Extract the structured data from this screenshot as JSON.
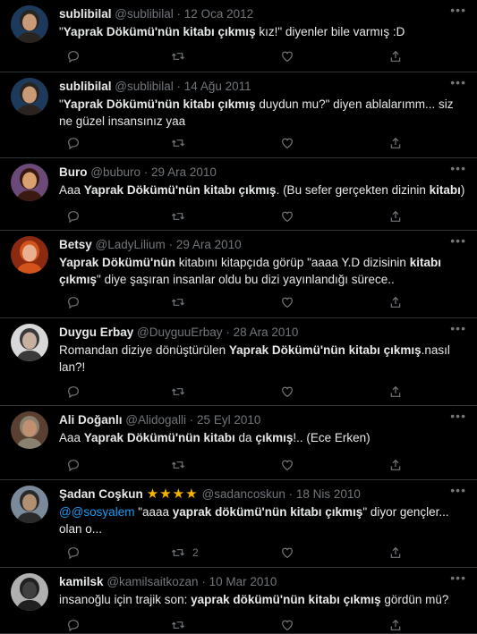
{
  "tweets": [
    {
      "name": "sublibilal",
      "handle": "@sublibilal",
      "dot": "·",
      "date": "12 Oca 2012",
      "text": [
        {
          "t": "\"",
          "b": false
        },
        {
          "t": "Yaprak Dökümü'nün kitabı çıkmış",
          "b": true
        },
        {
          "t": " kız!\" diyenler bile varmış :D",
          "b": false
        }
      ],
      "retweets": "",
      "avatar": {
        "bg": "#1d3a5c",
        "face": "#c89a78",
        "hair": "#2a2420"
      }
    },
    {
      "name": "sublibilal",
      "handle": "@sublibilal",
      "dot": "·",
      "date": "14 Ağu 2011",
      "text": [
        {
          "t": "\"",
          "b": false
        },
        {
          "t": "Yaprak Dökümü'nün kitabı çıkmış",
          "b": true
        },
        {
          "t": " duydun mu?\" diyen ablalarımm... siz ne güzel insansınız yaa",
          "b": false
        }
      ],
      "retweets": "",
      "avatar": {
        "bg": "#1d3a5c",
        "face": "#c89a78",
        "hair": "#2a2420"
      }
    },
    {
      "name": "Buro",
      "handle": "@buburo",
      "dot": "·",
      "date": "29 Ara 2010",
      "text": [
        {
          "t": "Aaa ",
          "b": false
        },
        {
          "t": "Yaprak Dökümü'nün kitabı çıkmış",
          "b": true
        },
        {
          "t": ". (Bu sefer gerçekten dizinin ",
          "b": false
        },
        {
          "t": "kitabı",
          "b": true
        },
        {
          "t": ")",
          "b": false
        }
      ],
      "retweets": "",
      "avatar": {
        "bg": "#6b4a7a",
        "face": "#d9a070",
        "hair": "#3a1a10"
      }
    },
    {
      "name": "Betsy",
      "handle": "@LadyLilium",
      "dot": "·",
      "date": "29 Ara 2010",
      "text": [
        {
          "t": "Yaprak Dökümü'nün",
          "b": true
        },
        {
          "t": " kitabını kitapçıda görüp \"aaaa Y.D dizisinin ",
          "b": false
        },
        {
          "t": "kitabı çıkmış",
          "b": true
        },
        {
          "t": "\" diye şaşıran insanlar oldu bu dizi yayınlandığı sürece..",
          "b": false
        }
      ],
      "retweets": "",
      "avatar": {
        "bg": "#8a2a10",
        "face": "#e8b090",
        "hair": "#d2541a"
      }
    },
    {
      "name": "Duygu Erbay",
      "handle": "@DuyguuErbay",
      "dot": "·",
      "date": "28 Ara 2010",
      "text": [
        {
          "t": "Romandan diziye dönüştürülen ",
          "b": false
        },
        {
          "t": "Yaprak Dökümü'nün kitabı çıkmış",
          "b": true
        },
        {
          "t": ".nasıl lan?!",
          "b": false
        }
      ],
      "retweets": "",
      "avatar": {
        "bg": "#d8d8d8",
        "face": "#c8b0a0",
        "hair": "#3a3a3a"
      }
    },
    {
      "name": "Ali Doğanlı",
      "handle": "@Alidogalli",
      "dot": "·",
      "date": "25 Eyl 2010",
      "text": [
        {
          "t": "Aaa ",
          "b": false
        },
        {
          "t": "Yaprak Dökümü'nün kitabı",
          "b": true
        },
        {
          "t": " da ",
          "b": false
        },
        {
          "t": "çıkmış",
          "b": true
        },
        {
          "t": "!..  (Ece Erken)",
          "b": false
        }
      ],
      "retweets": "",
      "avatar": {
        "bg": "#5a4030",
        "face": "#c09070",
        "hair": "#8a8070"
      }
    },
    {
      "name": "Şadan Coşkun",
      "stars": "★★★★",
      "handle": "@sadancoskun",
      "dot": "·",
      "date": "18 Nis 2010",
      "text": [
        {
          "t": "@",
          "b": false,
          "m": true
        },
        {
          "t": "@sosyalem",
          "b": false,
          "m": true
        },
        {
          "t": " \"aaaa ",
          "b": false
        },
        {
          "t": "yaprak dökümü'nün kitabı çıkmış",
          "b": true
        },
        {
          "t": "\" diyor gençler... olan o...",
          "b": false
        }
      ],
      "retweets": "2",
      "avatar": {
        "bg": "#7a8a9a",
        "face": "#b09070",
        "hair": "#2a2a2a"
      }
    },
    {
      "name": "kamilsk",
      "handle": "@kamilsaitkozan",
      "dot": "·",
      "date": "10 Mar 2010",
      "text": [
        {
          "t": "insanoğlu için trajik son: ",
          "b": false
        },
        {
          "t": "yaprak dökümü'nün kitabı çıkmış",
          "b": true
        },
        {
          "t": " gördün mü?",
          "b": false
        }
      ],
      "retweets": "",
      "avatar": {
        "bg": "#b0b0b0",
        "face": "#404040",
        "hair": "#202020"
      }
    }
  ],
  "icons": {
    "reply": "reply-icon",
    "retweet": "retweet-icon",
    "like": "like-icon",
    "share": "share-icon",
    "more": "more-icon"
  },
  "colors": {
    "background": "#000000",
    "text": "#e7e9ea",
    "muted": "#71767b",
    "mention": "#1d9bf0",
    "star": "#f5b400",
    "divider": "#2f3336"
  }
}
